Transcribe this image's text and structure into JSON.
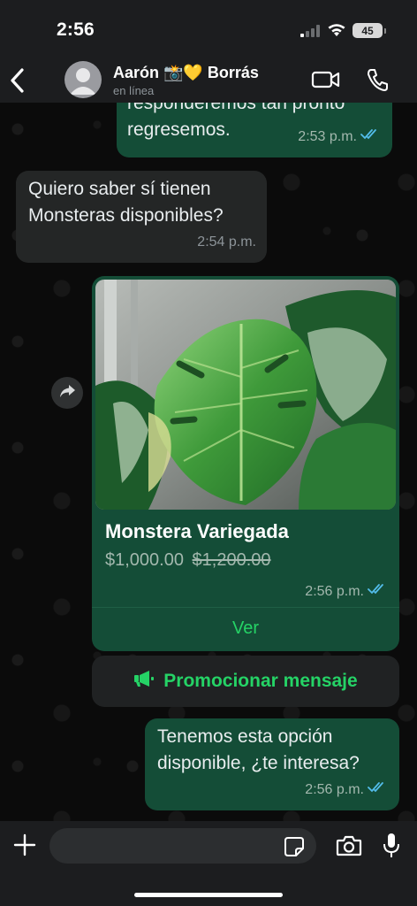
{
  "status_bar": {
    "time": "2:56",
    "battery": "45"
  },
  "header": {
    "contact_name": "Aarón 📸💛 Borrás",
    "status": "en línea"
  },
  "messages": [
    {
      "direction": "outgoing",
      "text": "responderemos tan pronto\nregresemos.",
      "time": "2:53 p.m.",
      "read": true
    },
    {
      "direction": "incoming",
      "text": "Quiero saber sí tienen\nMonsteras disponibles?",
      "time": "2:54 p.m."
    },
    {
      "direction": "outgoing",
      "text": "Tenemos esta opción\ndisponible, ¿te interesa?",
      "time": "2:56 p.m.",
      "read": true
    }
  ],
  "product": {
    "title": "Monstera Variegada",
    "price": "$1,000.00",
    "old_price": "$1,200.00",
    "time": "2:56 p.m.",
    "view_label": "Ver"
  },
  "promote": {
    "label": "Promocionar mensaje"
  },
  "input": {
    "placeholder": ""
  },
  "colors": {
    "outgoing_bubble": "#144d37",
    "incoming_bubble": "#242626",
    "accent": "#25d366",
    "read_ticks": "#53bdeb"
  }
}
